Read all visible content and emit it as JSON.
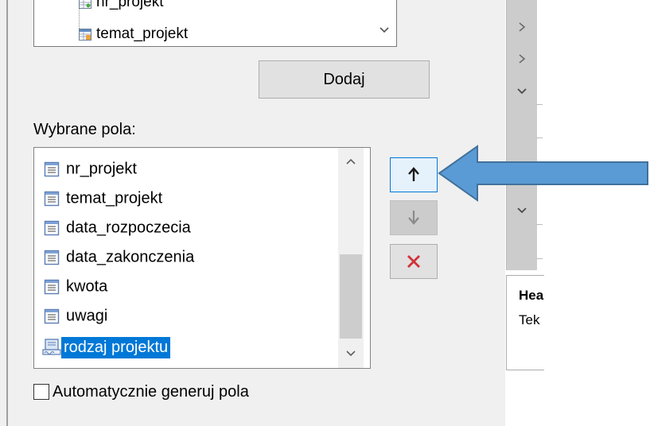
{
  "top_list": {
    "items": [
      {
        "label": "nr_projekt",
        "icon": "linked-table-icon"
      },
      {
        "label": "temat_projekt",
        "icon": "table-field-icon"
      }
    ]
  },
  "add_button": {
    "label": "Dodaj"
  },
  "selected_fields": {
    "label": "Wybrane pola:",
    "items": [
      {
        "label": "nr_projekt",
        "icon": "field-icon",
        "selected": false
      },
      {
        "label": "temat_projekt",
        "icon": "field-icon",
        "selected": false
      },
      {
        "label": "data_rozpoczecia",
        "icon": "field-icon",
        "selected": false
      },
      {
        "label": "data_zakonczenia",
        "icon": "field-icon",
        "selected": false
      },
      {
        "label": "kwota",
        "icon": "field-icon",
        "selected": false
      },
      {
        "label": "uwagi",
        "icon": "field-icon",
        "selected": false
      },
      {
        "label": "rodzaj projektu",
        "icon": "lookup-field-icon",
        "selected": true
      }
    ]
  },
  "side_buttons": {
    "move_up": {
      "icon": "arrow-up-icon"
    },
    "move_down": {
      "icon": "arrow-down-icon",
      "disabled": true
    },
    "delete": {
      "icon": "delete-x-icon",
      "color": "#d13438"
    }
  },
  "auto_generate": {
    "label": "Automatycznie generuj pola",
    "checked": false
  },
  "right_panel": {
    "heading": "Hea",
    "text": "Tek"
  },
  "colors": {
    "selection": "#0078d7",
    "callout_arrow": "#5b9bd5",
    "callout_arrow_border": "#41719c"
  }
}
